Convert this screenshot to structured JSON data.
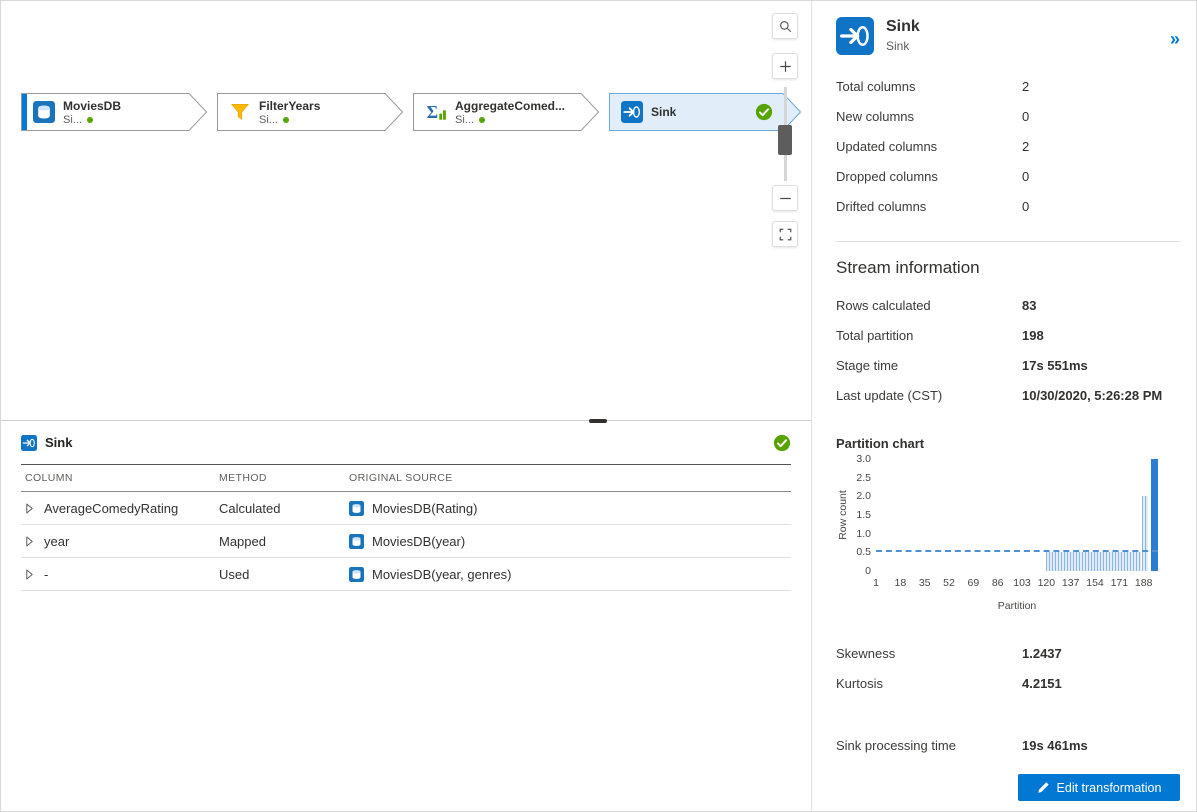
{
  "canvas": {
    "nodes": [
      {
        "title": "MoviesDB",
        "subtitle": "Si...",
        "icon": "database-icon",
        "selected": false,
        "status": null
      },
      {
        "title": "FilterYears",
        "subtitle": "Si...",
        "icon": "filter-icon",
        "selected": false,
        "status": null
      },
      {
        "title": "AggregateComed...",
        "subtitle": "Si...",
        "icon": "aggregate-icon",
        "selected": false,
        "status": null
      },
      {
        "title": "Sink",
        "subtitle": "",
        "icon": "sink-icon",
        "selected": true,
        "status": "success"
      }
    ],
    "zoom_controls": {
      "search": "search",
      "zoom_in": "+",
      "zoom_out": "−",
      "fit": "fit-to-screen"
    }
  },
  "bottom_panel": {
    "title": "Sink",
    "columns": [
      "COLUMN",
      "METHOD",
      "ORIGINAL SOURCE"
    ],
    "rows": [
      {
        "column": "AverageComedyRating",
        "method": "Calculated",
        "source": "MoviesDB(Rating)"
      },
      {
        "column": "year",
        "method": "Mapped",
        "source": "MoviesDB(year)"
      },
      {
        "column": "-",
        "method": "Used",
        "source": "MoviesDB(year, genres)"
      }
    ]
  },
  "details": {
    "title": "Sink",
    "subtitle": "Sink",
    "collapse_icon": "»",
    "stats": [
      {
        "label": "Total columns",
        "value": "2"
      },
      {
        "label": "New columns",
        "value": "0"
      },
      {
        "label": "Updated columns",
        "value": "2"
      },
      {
        "label": "Dropped columns",
        "value": "0"
      },
      {
        "label": "Drifted columns",
        "value": "0"
      }
    ],
    "stream_info": {
      "heading": "Stream information",
      "rows": [
        {
          "label": "Rows calculated",
          "value": "83"
        },
        {
          "label": "Total partition",
          "value": "198"
        },
        {
          "label": "Stage time",
          "value": "17s 551ms"
        },
        {
          "label": "Last update (CST)",
          "value": "10/30/2020, 5:26:28 PM"
        }
      ]
    },
    "partition_chart_title": "Partition chart",
    "metrics": [
      {
        "label": "Skewness",
        "value": "1.2437"
      },
      {
        "label": "Kurtosis",
        "value": "4.2151"
      }
    ],
    "sink_time": [
      {
        "label": "Sink processing time",
        "value": "19s 461ms"
      }
    ],
    "edit_button": "Edit transformation"
  },
  "chart_data": {
    "type": "bar",
    "title": "Partition chart",
    "xlabel": "Partition",
    "ylabel": "Row count",
    "ylim": [
      0,
      3
    ],
    "yticks": [
      "3.0",
      "2.5",
      "2.0",
      "1.5",
      "1.0",
      "0.5",
      "0"
    ],
    "xticks": [
      1,
      18,
      35,
      52,
      69,
      86,
      103,
      120,
      137,
      154,
      171,
      188
    ],
    "num_partitions": 198,
    "avg_line": 0.5,
    "legend": "none",
    "grid": false,
    "bars": [
      {
        "start": 120,
        "end": 186,
        "value": 0.5,
        "fill": "light"
      },
      {
        "start": 187,
        "end": 191,
        "value": 2.0,
        "fill": "light"
      },
      {
        "start": 193,
        "end": 198,
        "value": 3.0,
        "fill": "solid"
      }
    ]
  },
  "colors": {
    "accent": "#0078d4",
    "success": "#57a300",
    "selected_node_fill": "#e1eefa",
    "chart_bar": "#2c7cd2"
  }
}
